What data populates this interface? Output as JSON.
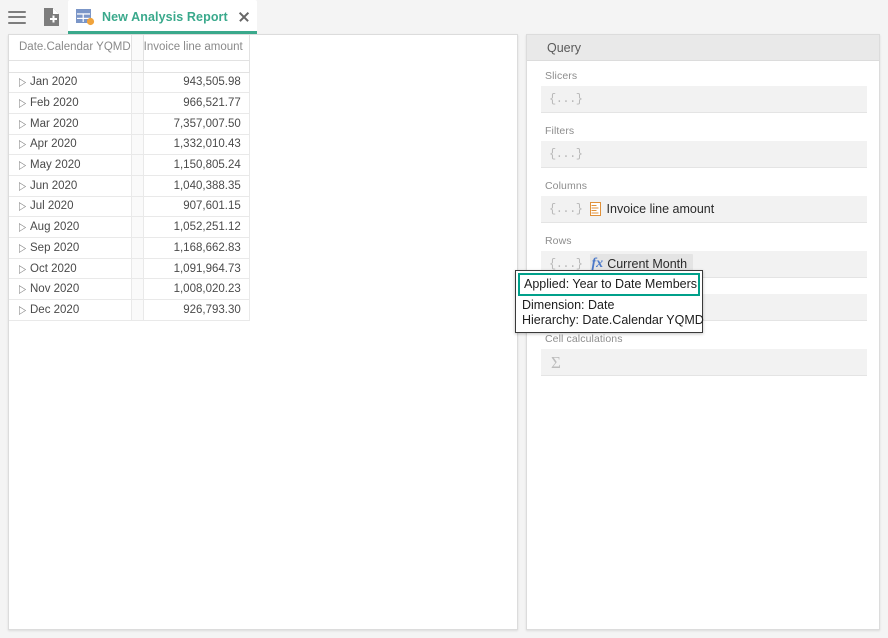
{
  "topbar": {
    "menu_icon": "hamburger-menu-icon",
    "new_icon": "new-document-icon",
    "tab": {
      "icon": "analysis-grid-icon",
      "title": "New Analysis Report",
      "close_icon": "close-icon"
    }
  },
  "grid": {
    "headers": {
      "row_dimension": "Date.Calendar YQMD",
      "measure": "Invoice line amount"
    },
    "expander_glyph": "▷",
    "rows": [
      {
        "label": "Jan 2020",
        "value": "943,505.98"
      },
      {
        "label": "Feb 2020",
        "value": "966,521.77"
      },
      {
        "label": "Mar 2020",
        "value": "7,357,007.50"
      },
      {
        "label": "Apr 2020",
        "value": "1,332,010.43"
      },
      {
        "label": "May 2020",
        "value": "1,150,805.24"
      },
      {
        "label": "Jun 2020",
        "value": "1,040,388.35"
      },
      {
        "label": "Jul 2020",
        "value": "907,601.15"
      },
      {
        "label": "Aug 2020",
        "value": "1,052,251.12"
      },
      {
        "label": "Sep 2020",
        "value": "1,168,662.83"
      },
      {
        "label": "Oct 2020",
        "value": "1,091,964.73"
      },
      {
        "label": "Nov 2020",
        "value": "1,008,020.23"
      },
      {
        "label": "Dec 2020",
        "value": "926,793.30"
      }
    ]
  },
  "query": {
    "title": "Query",
    "placeholder_dots": "{...}",
    "sections": [
      {
        "label": "Slicers",
        "item": null
      },
      {
        "label": "Filters",
        "item": null
      },
      {
        "label": "Columns",
        "item": "Invoice line amount",
        "icon": "measure-icon"
      },
      {
        "label": "Rows",
        "item": "Current Month",
        "icon": "fx-calculation-icon"
      }
    ],
    "hidden_section": {
      "label": "",
      "item": null
    },
    "cell_calculations": {
      "label": "Cell calculations",
      "icon": "sigma-icon"
    }
  },
  "tooltip": {
    "applied": "Applied: Year to Date Members",
    "dimension": "Dimension: Date",
    "hierarchy": "Hierarchy: Date.Calendar YQMD"
  },
  "colors": {
    "accent_teal": "#3aa98c",
    "tooltip_highlight": "#00a08a",
    "measure_orange": "#e0913a",
    "fx_blue": "#4a78c8"
  }
}
